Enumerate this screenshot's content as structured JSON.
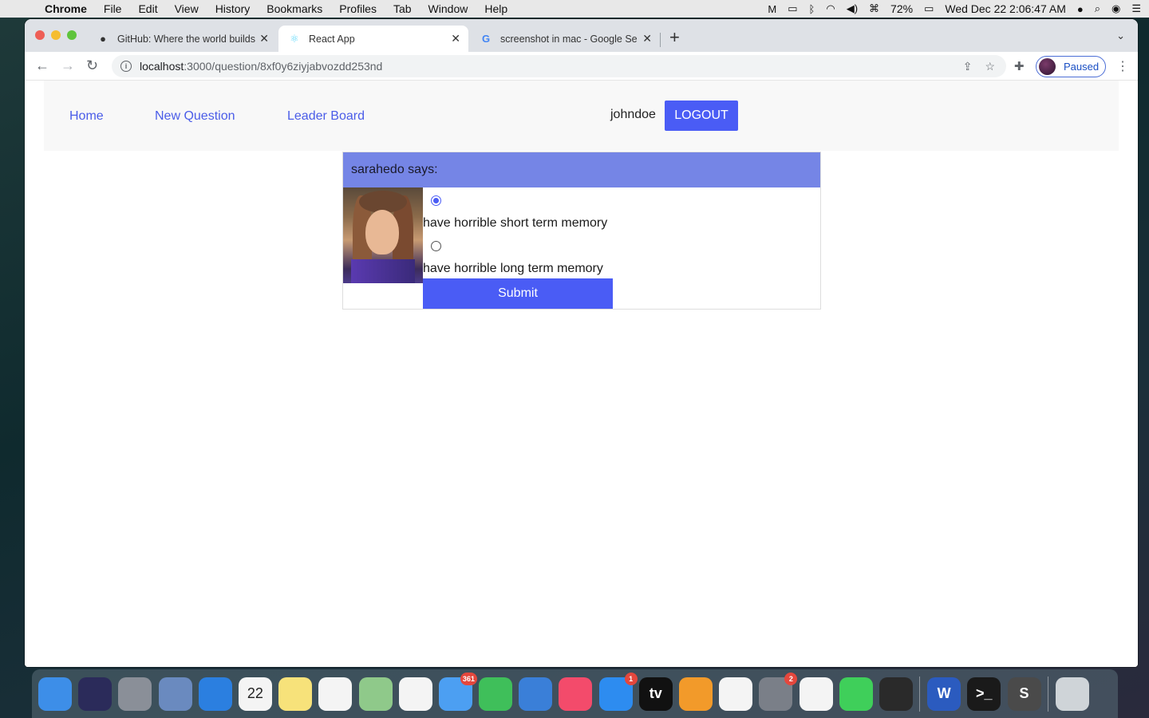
{
  "menubar": {
    "app_name": "Chrome",
    "menus": [
      "File",
      "Edit",
      "View",
      "History",
      "Bookmarks",
      "Profiles",
      "Tab",
      "Window",
      "Help"
    ],
    "battery": "72%",
    "datetime": "Wed Dec 22  2:06:47 AM"
  },
  "browser": {
    "tabs": [
      {
        "title": "GitHub: Where the world builds",
        "icon": "github-icon"
      },
      {
        "title": "React App",
        "icon": "react-icon"
      },
      {
        "title": "screenshot in mac - Google Se",
        "icon": "google-icon"
      }
    ],
    "url_host": "localhost",
    "url_path": ":3000/question/8xf0y6ziyjabvozdd253nd",
    "profile_status": "Paused"
  },
  "app": {
    "nav": {
      "home": "Home",
      "new_question": "New Question",
      "leader_board": "Leader Board",
      "username": "johndoe",
      "logout": "LOGOUT"
    },
    "question": {
      "author_line": "sarahedo says:",
      "option_one": "have horrible short term memory",
      "option_two": "have horrible long term memory",
      "selected": "option_one",
      "submit": "Submit"
    }
  },
  "dock": {
    "apps": [
      {
        "name": "Finder",
        "icon": "finder-icon",
        "color": "#3d8ee8"
      },
      {
        "name": "Siri",
        "icon": "siri-icon",
        "color": "#2b2b5a"
      },
      {
        "name": "Launchpad",
        "icon": "rocket-icon",
        "color": "#8a8f98"
      },
      {
        "name": "Mail Stamp",
        "icon": "stamp-icon",
        "color": "#6a8abf"
      },
      {
        "name": "Safari",
        "icon": "compass-icon",
        "color": "#2b7fe0"
      },
      {
        "name": "Calendar",
        "icon": "calendar-icon",
        "color": "#f4f4f4",
        "label": "22"
      },
      {
        "name": "Notes",
        "icon": "notes-icon",
        "color": "#f7e27a"
      },
      {
        "name": "Reminders",
        "icon": "reminders-icon",
        "color": "#f4f4f4"
      },
      {
        "name": "Maps",
        "icon": "maps-icon",
        "color": "#8fc98a"
      },
      {
        "name": "Photos",
        "icon": "photos-icon",
        "color": "#f4f4f4"
      },
      {
        "name": "Messages",
        "icon": "messages-icon",
        "color": "#4c9ff2",
        "badge": "361"
      },
      {
        "name": "FaceTime",
        "icon": "facetime-icon",
        "color": "#3fbf5a"
      },
      {
        "name": "Keynote",
        "icon": "keynote-icon",
        "color": "#3a7fd8"
      },
      {
        "name": "Music",
        "icon": "music-icon",
        "color": "#f34b6b"
      },
      {
        "name": "App Store",
        "icon": "appstore-icon",
        "color": "#2d8cf0",
        "badge": "1"
      },
      {
        "name": "TV",
        "icon": "tv-icon",
        "color": "#111111",
        "label": "tv"
      },
      {
        "name": "Books",
        "icon": "books-icon",
        "color": "#f29a2a"
      },
      {
        "name": "VS Code",
        "icon": "vscode-icon",
        "color": "#f4f4f4"
      },
      {
        "name": "System Preferences",
        "icon": "gear-icon",
        "color": "#7a7f88",
        "badge": "2"
      },
      {
        "name": "Chrome",
        "icon": "chrome-icon",
        "color": "#f4f4f4"
      },
      {
        "name": "WhatsApp",
        "icon": "whatsapp-icon",
        "color": "#3fcf5a"
      },
      {
        "name": "Screen Capture",
        "icon": "capture-icon",
        "color": "#2a2a2a"
      },
      {
        "name": "Word",
        "icon": "word-icon",
        "color": "#2b5bbf",
        "label": "W"
      },
      {
        "name": "Terminal",
        "icon": "terminal-icon",
        "color": "#1a1a1a",
        "label": ">_"
      },
      {
        "name": "Sublime Text",
        "icon": "sublime-icon",
        "color": "#4a4a4a",
        "label": "S"
      },
      {
        "name": "Trash",
        "icon": "trash-icon",
        "color": "#cfd4d8"
      }
    ]
  }
}
